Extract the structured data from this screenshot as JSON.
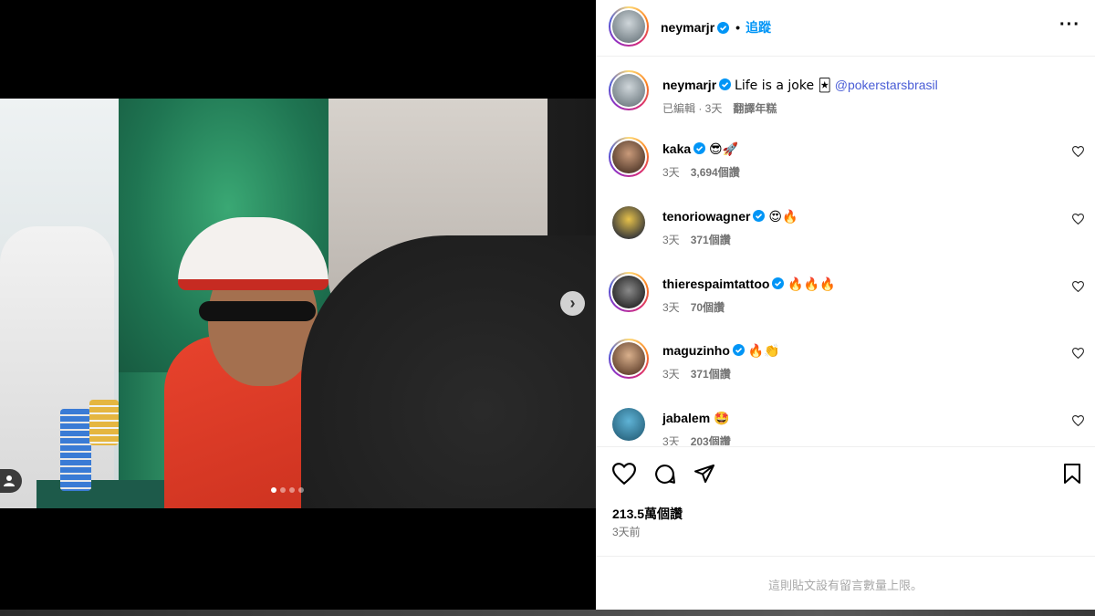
{
  "post": {
    "slide_count": 4,
    "active_slide": 1
  },
  "header": {
    "username": "neymarjr",
    "separator": "•",
    "follow_label": "追蹤",
    "more_label": "···"
  },
  "caption": {
    "username": "neymarjr",
    "text": "Life is a joke 🃏",
    "mention": "@pokerstarsbrasil",
    "edited": "已編輯 · 3天",
    "translate": "翻譯年糕"
  },
  "comments": [
    {
      "username": "kaka",
      "text": "😎🚀",
      "time": "3天",
      "likes": "3,694個讚",
      "verified": true
    },
    {
      "username": "tenoriowagner",
      "text": "😍🔥",
      "time": "3天",
      "likes": "371個讚",
      "verified": true
    },
    {
      "username": "thierespaimtattoo",
      "text": "🔥🔥🔥",
      "time": "3天",
      "likes": "70個讚",
      "verified": true
    },
    {
      "username": "maguzinho",
      "text": "🔥👏",
      "time": "3天",
      "likes": "371個讚",
      "verified": true
    },
    {
      "username": "jabalem",
      "text": "🤩",
      "time": "3天",
      "likes": "203個讚",
      "verified": false
    }
  ],
  "actions": {
    "likes": "213.5萬個讚",
    "time": "3天前"
  },
  "footer": {
    "text": "這則貼文設有留言數量上限。"
  },
  "colors": {
    "accent": "#0095f6",
    "mention": "#4a5dd6",
    "verified": "#0095f6"
  }
}
